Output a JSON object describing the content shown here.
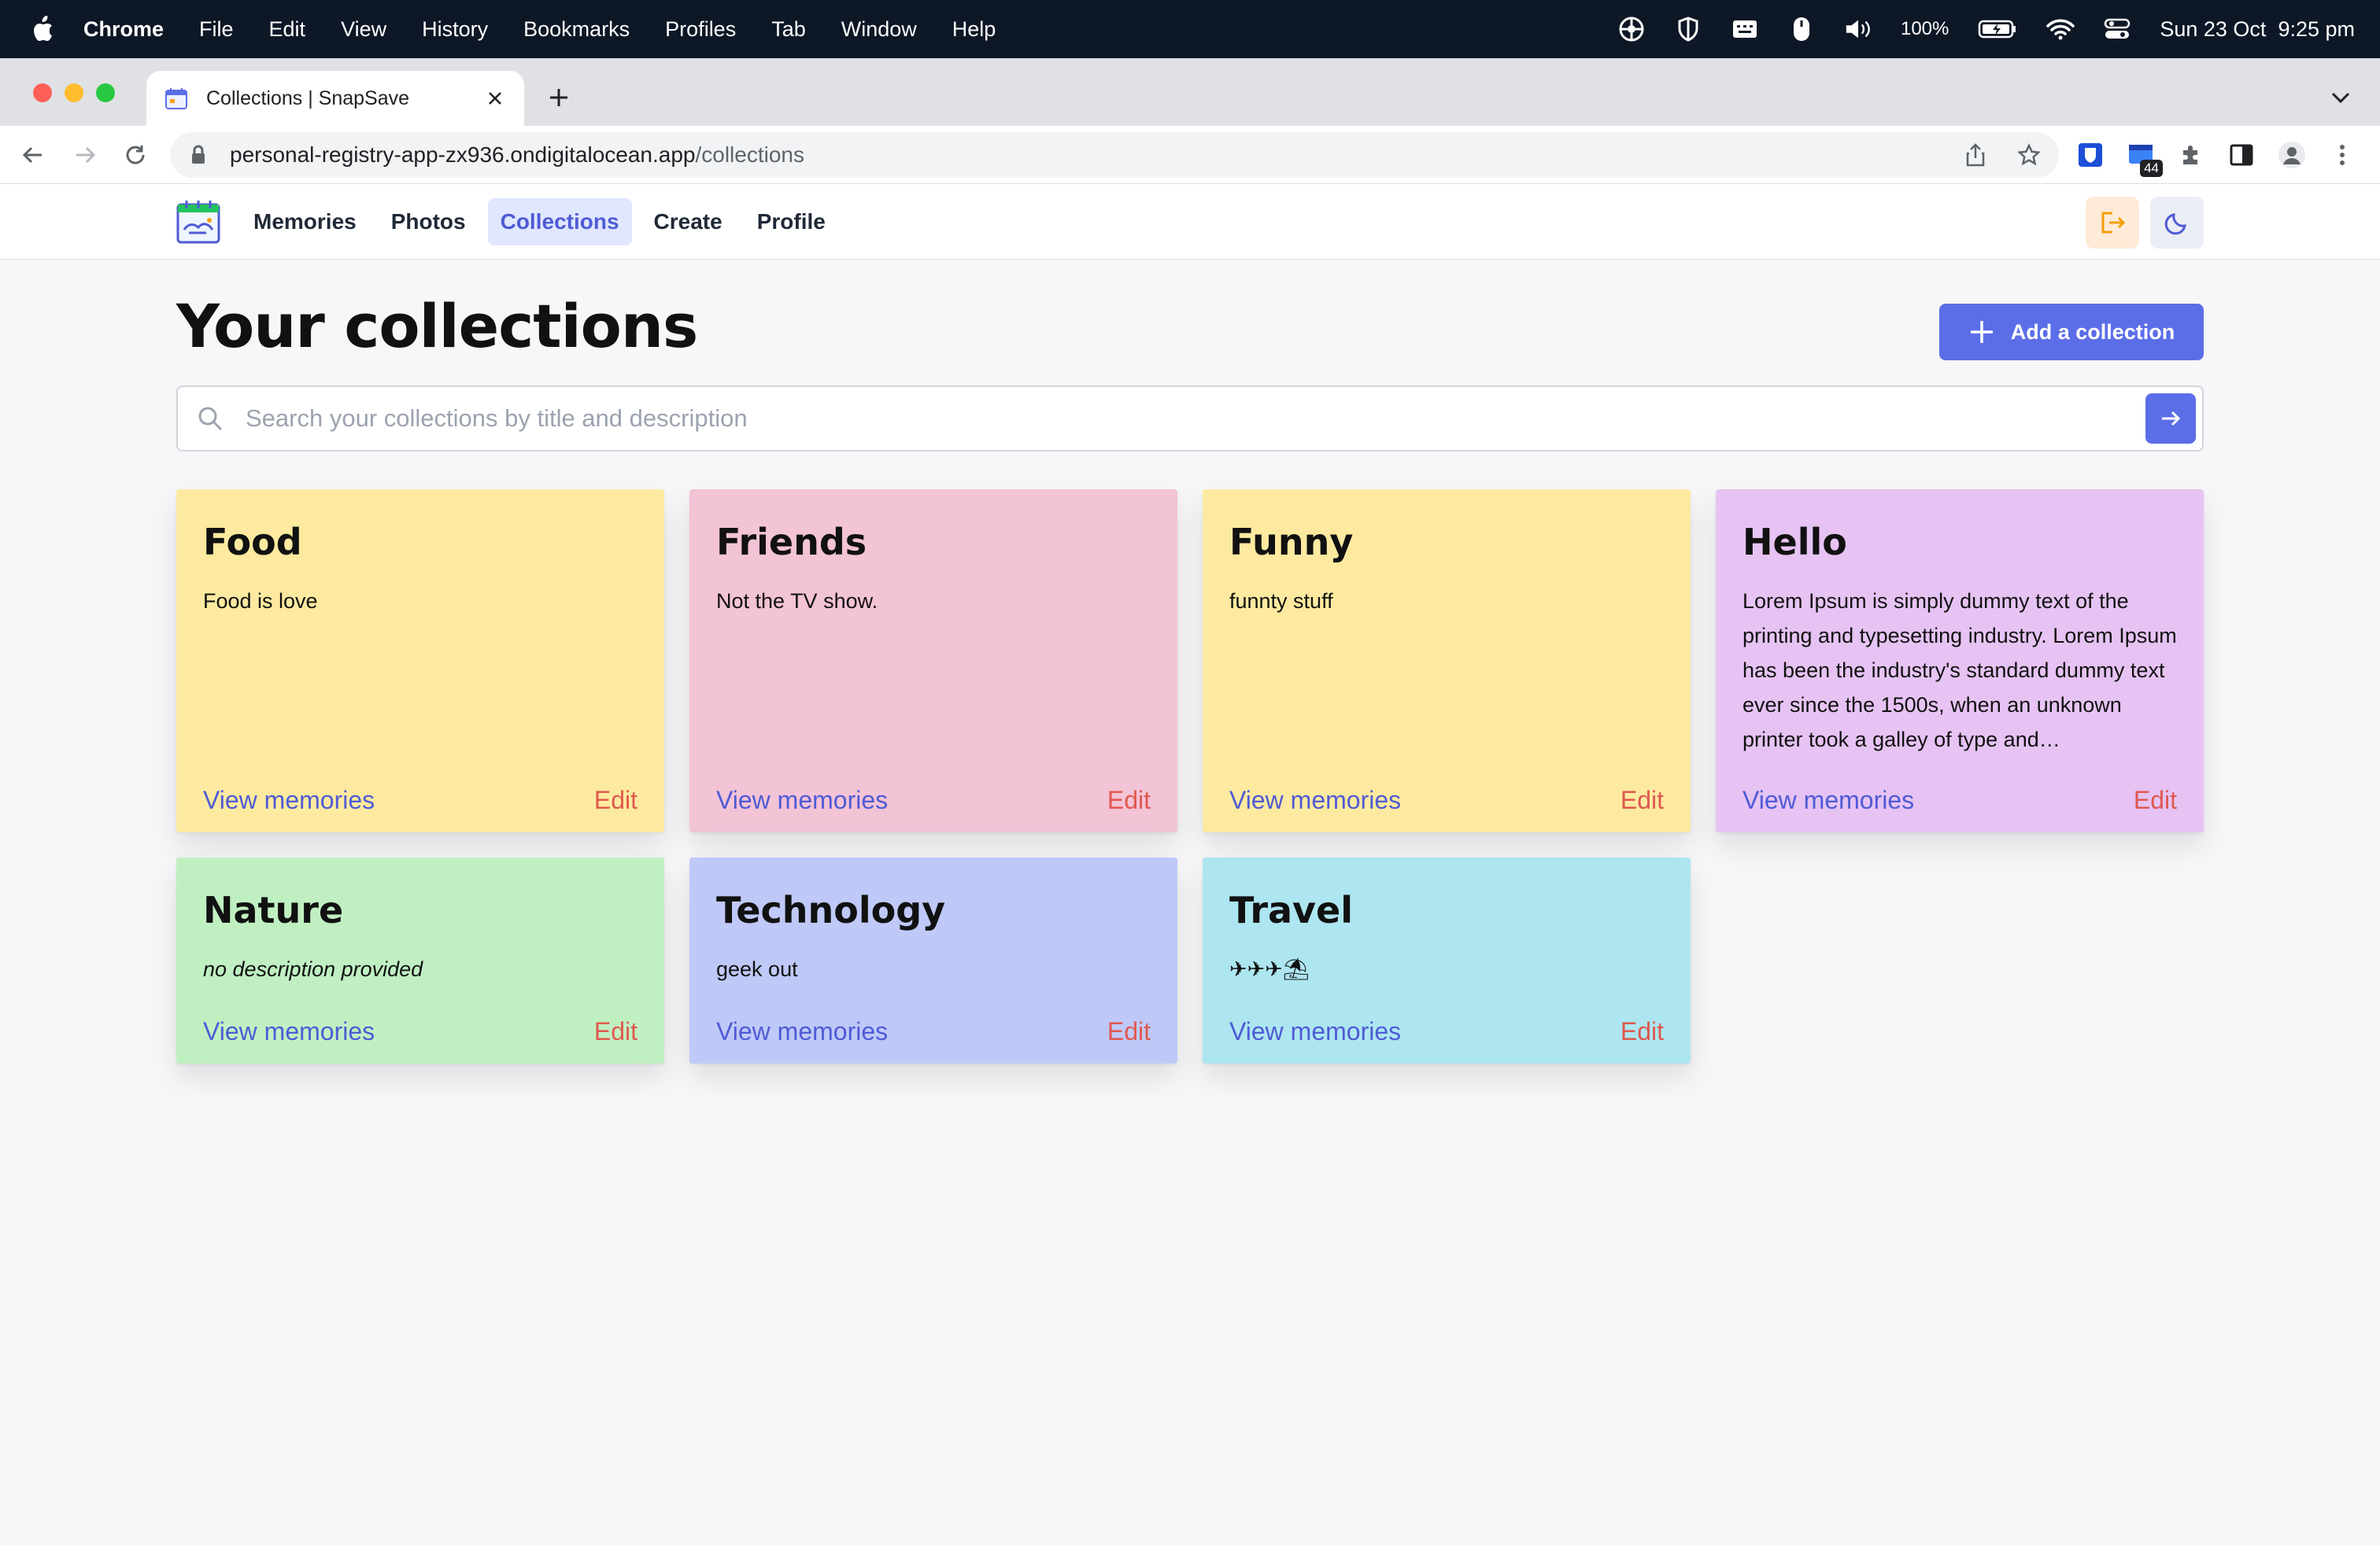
{
  "menubar": {
    "app": "Chrome",
    "items": [
      "File",
      "Edit",
      "View",
      "History",
      "Bookmarks",
      "Profiles",
      "Tab",
      "Window",
      "Help"
    ],
    "battery": "100%",
    "datetime": "Sun 23 Oct  9:25 pm"
  },
  "browser": {
    "tab_title": "Collections | SnapSave",
    "url_host": "personal-registry-app-zx936.ondigitalocean.app",
    "url_path": "/collections",
    "extension_badge": "44"
  },
  "nav": {
    "links": [
      "Memories",
      "Photos",
      "Collections",
      "Create",
      "Profile"
    ],
    "active": "Collections"
  },
  "page": {
    "title": "Your collections",
    "add_button": "Add a collection",
    "search_placeholder": "Search your collections by title and description"
  },
  "colors": {
    "accent": "#5b6ee8",
    "link": "#4f5bd5",
    "edit": "#e0584e"
  },
  "collections": [
    {
      "title": "Food",
      "description": "Food is love",
      "color": "#fdeaa0",
      "view": "View memories",
      "edit": "Edit"
    },
    {
      "title": "Friends",
      "description": "Not the TV show.",
      "color": "#f3c3d6",
      "view": "View memories",
      "edit": "Edit"
    },
    {
      "title": "Funny",
      "description": "funnty stuff",
      "color": "#fdeaa0",
      "view": "View memories",
      "edit": "Edit"
    },
    {
      "title": "Hello",
      "description": "Lorem Ipsum is simply dummy text of the printing and typesetting industry. Lorem Ipsum has been the industry's standard dummy text ever since the 1500s, when an unknown printer took a galley of type and…",
      "color": "#e6c3f3",
      "view": "View memories",
      "edit": "Edit"
    },
    {
      "title": "Nature",
      "description": "no description provided",
      "color": "#c0f0c2",
      "view": "View memories",
      "edit": "Edit"
    },
    {
      "title": "Technology",
      "description": "geek out",
      "color": "#bfc9f8",
      "view": "View memories",
      "edit": "Edit"
    },
    {
      "title": "Travel",
      "description": "✈✈✈⛱",
      "color": "#ade6f0",
      "view": "View memories",
      "edit": "Edit"
    }
  ]
}
